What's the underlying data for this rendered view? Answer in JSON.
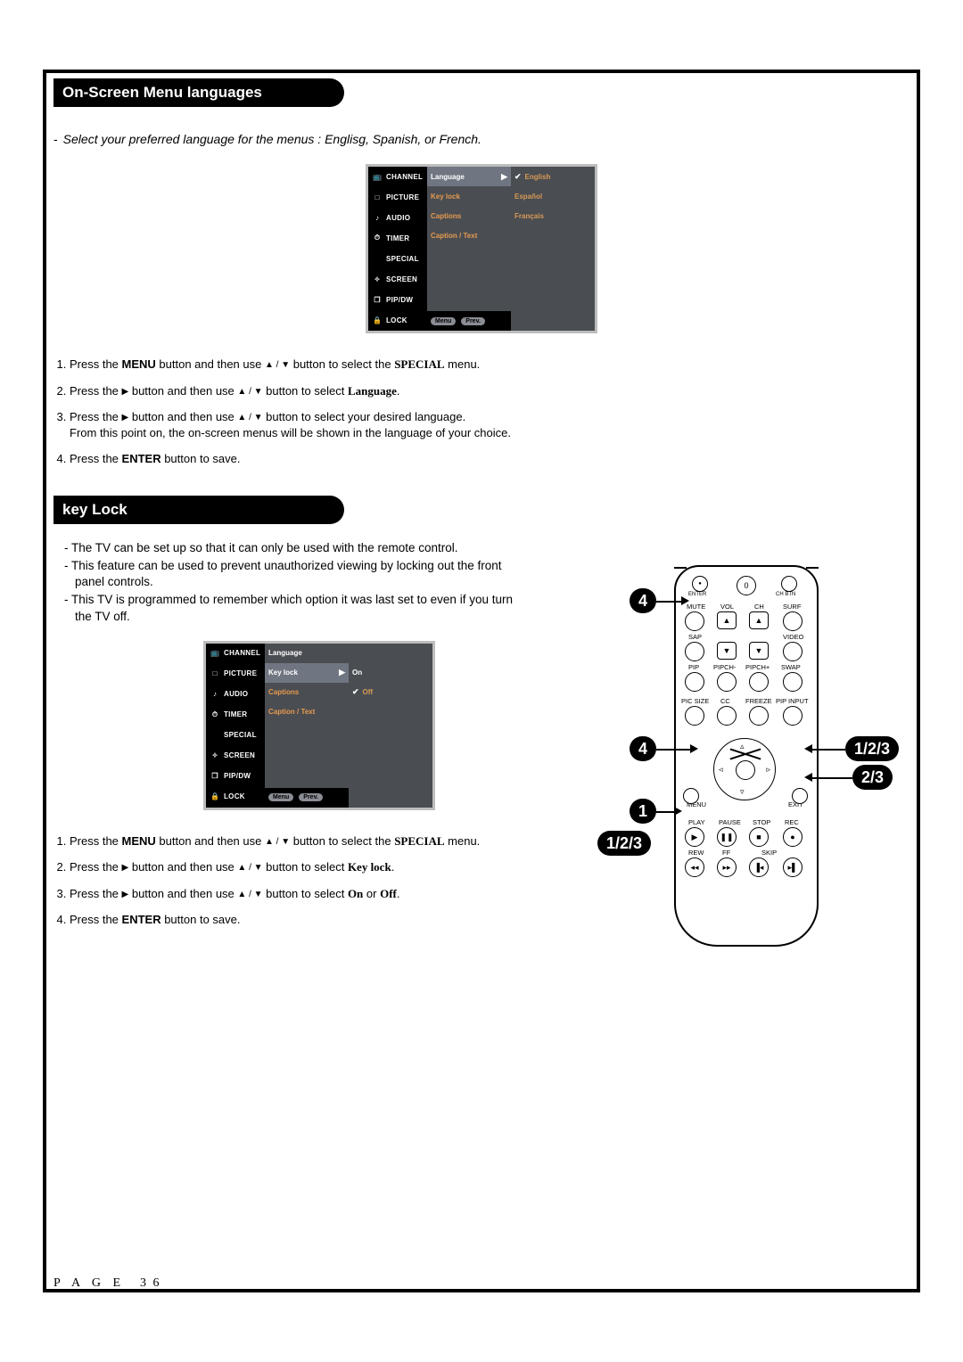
{
  "page": {
    "number_label": "P A G E",
    "number": "3 6"
  },
  "section1": {
    "title": "On-Screen Menu languages",
    "intro": "Select your preferred language for the menus : Englisg, Spanish, or French.",
    "osd": {
      "categories": [
        "CHANNEL",
        "PICTURE",
        "AUDIO",
        "TIMER",
        "SPECIAL",
        "SCREEN",
        "PIP/DW",
        "LOCK"
      ],
      "options": [
        "Language",
        "Key lock",
        "Captions",
        "Caption / Text"
      ],
      "selected": "Language",
      "values": [
        "English",
        "Español",
        "Français"
      ],
      "checked": "English",
      "footer": [
        "Menu",
        "Prev."
      ]
    },
    "steps": [
      {
        "pre": "Press the ",
        "b1": "MENU",
        "mid": " button and then use ",
        "arrows": "▲ / ▼",
        "post": " button to select the ",
        "b2": "SPECIAL",
        "tail": " menu."
      },
      {
        "pre": "Press the ",
        "b1": "▶",
        "mid": " button and then use ",
        "arrows": "▲ / ▼",
        "post": " button to select ",
        "b2": "Language",
        "tail": "."
      },
      {
        "pre": "Press the ",
        "b1": "▶",
        "mid": " button and then use ",
        "arrows": "▲ / ▼",
        "post": " button to select your desired language.",
        "line2": "From this point on, the on-screen menus will be shown in the language of your choice."
      },
      {
        "pre": "Press the ",
        "b1": "ENTER",
        "mid": " button to save."
      }
    ]
  },
  "section2": {
    "title": "key Lock",
    "bullets": [
      "The TV can be set up so that it can only be used with the remote control.",
      "This feature can be used to prevent unauthorized viewing by locking out the front panel controls.",
      "This TV is programmed to remember which option it was last set to even if you turn the TV off."
    ],
    "osd": {
      "categories": [
        "CHANNEL",
        "PICTURE",
        "AUDIO",
        "TIMER",
        "SPECIAL",
        "SCREEN",
        "PIP/DW",
        "LOCK"
      ],
      "options": [
        "Language",
        "Key lock",
        "Captions",
        "Caption / Text"
      ],
      "selected": "Key lock",
      "values": [
        "On",
        "Off"
      ],
      "checked": "Off",
      "footer": [
        "Menu",
        "Prev."
      ]
    },
    "steps": [
      {
        "pre": "Press the ",
        "b1": "MENU",
        "mid": " button and then use ",
        "arrows": "▲ / ▼",
        "post": " button to select the ",
        "b2": "SPECIAL",
        "tail": " menu."
      },
      {
        "pre": "Press the ",
        "b1": "▶",
        "mid": " button and then use ",
        "arrows": "▲ / ▼",
        "post": " button to select ",
        "b2": "Key lock",
        "tail": "."
      },
      {
        "pre": "Press the ",
        "b1": "▶",
        "mid": " button and then use ",
        "arrows": "▲ / ▼",
        "post": " button to select ",
        "b2": "On",
        "tail": " or ",
        "b3": "Off",
        "tail2": "."
      },
      {
        "pre": "Press the ",
        "b1": "ENTER",
        "mid": " button to save."
      }
    ]
  },
  "remote": {
    "top_row": {
      "enter": "ENTER",
      "zero": "0",
      "chbtn": "CH BTN"
    },
    "labels_row1": [
      "MUTE",
      "VOL",
      "CH",
      "SURF"
    ],
    "labels_row2": [
      "SAP",
      "",
      "",
      "VIDEO"
    ],
    "labels_row3": [
      "PIP",
      "PIPCH-",
      "PIPCH+",
      "SWAP"
    ],
    "labels_row4": [
      "PIC SIZE",
      "CC",
      "FREEZE",
      "PIP INPUT"
    ],
    "dpad": {
      "menu": "MENU",
      "exit": "EXIT"
    },
    "transport_row1": [
      "PLAY",
      "PAUSE",
      "STOP",
      "REC"
    ],
    "transport_row2": [
      "REW",
      "FF",
      "SKIP",
      ""
    ]
  },
  "callouts": {
    "c4a": "4",
    "c4b": "4",
    "c1": "1",
    "c123a": "1/2/3",
    "c123b": "1/2/3",
    "c23": "2/3"
  }
}
